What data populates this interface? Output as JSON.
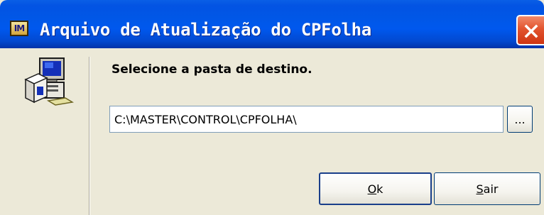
{
  "window": {
    "title": "Arquivo de Atualização do CPFolha",
    "icon_text": "IM"
  },
  "dialog": {
    "prompt": "Selecione a pasta de destino.",
    "path_value": "C:\\MASTER\\CONTROL\\CPFOLHA\\",
    "browse_label": "..."
  },
  "buttons": {
    "ok_mnemonic": "O",
    "ok_rest": "k",
    "sair_mnemonic": "S",
    "sair_rest": "air"
  },
  "icons": {
    "title": "app-logo-icon",
    "close": "close-icon",
    "setup": "setup-computer-icon"
  },
  "colors": {
    "titlebar": "#0058EE",
    "close_button": "#E2542F",
    "dialog_bg": "#ECE9D8"
  }
}
